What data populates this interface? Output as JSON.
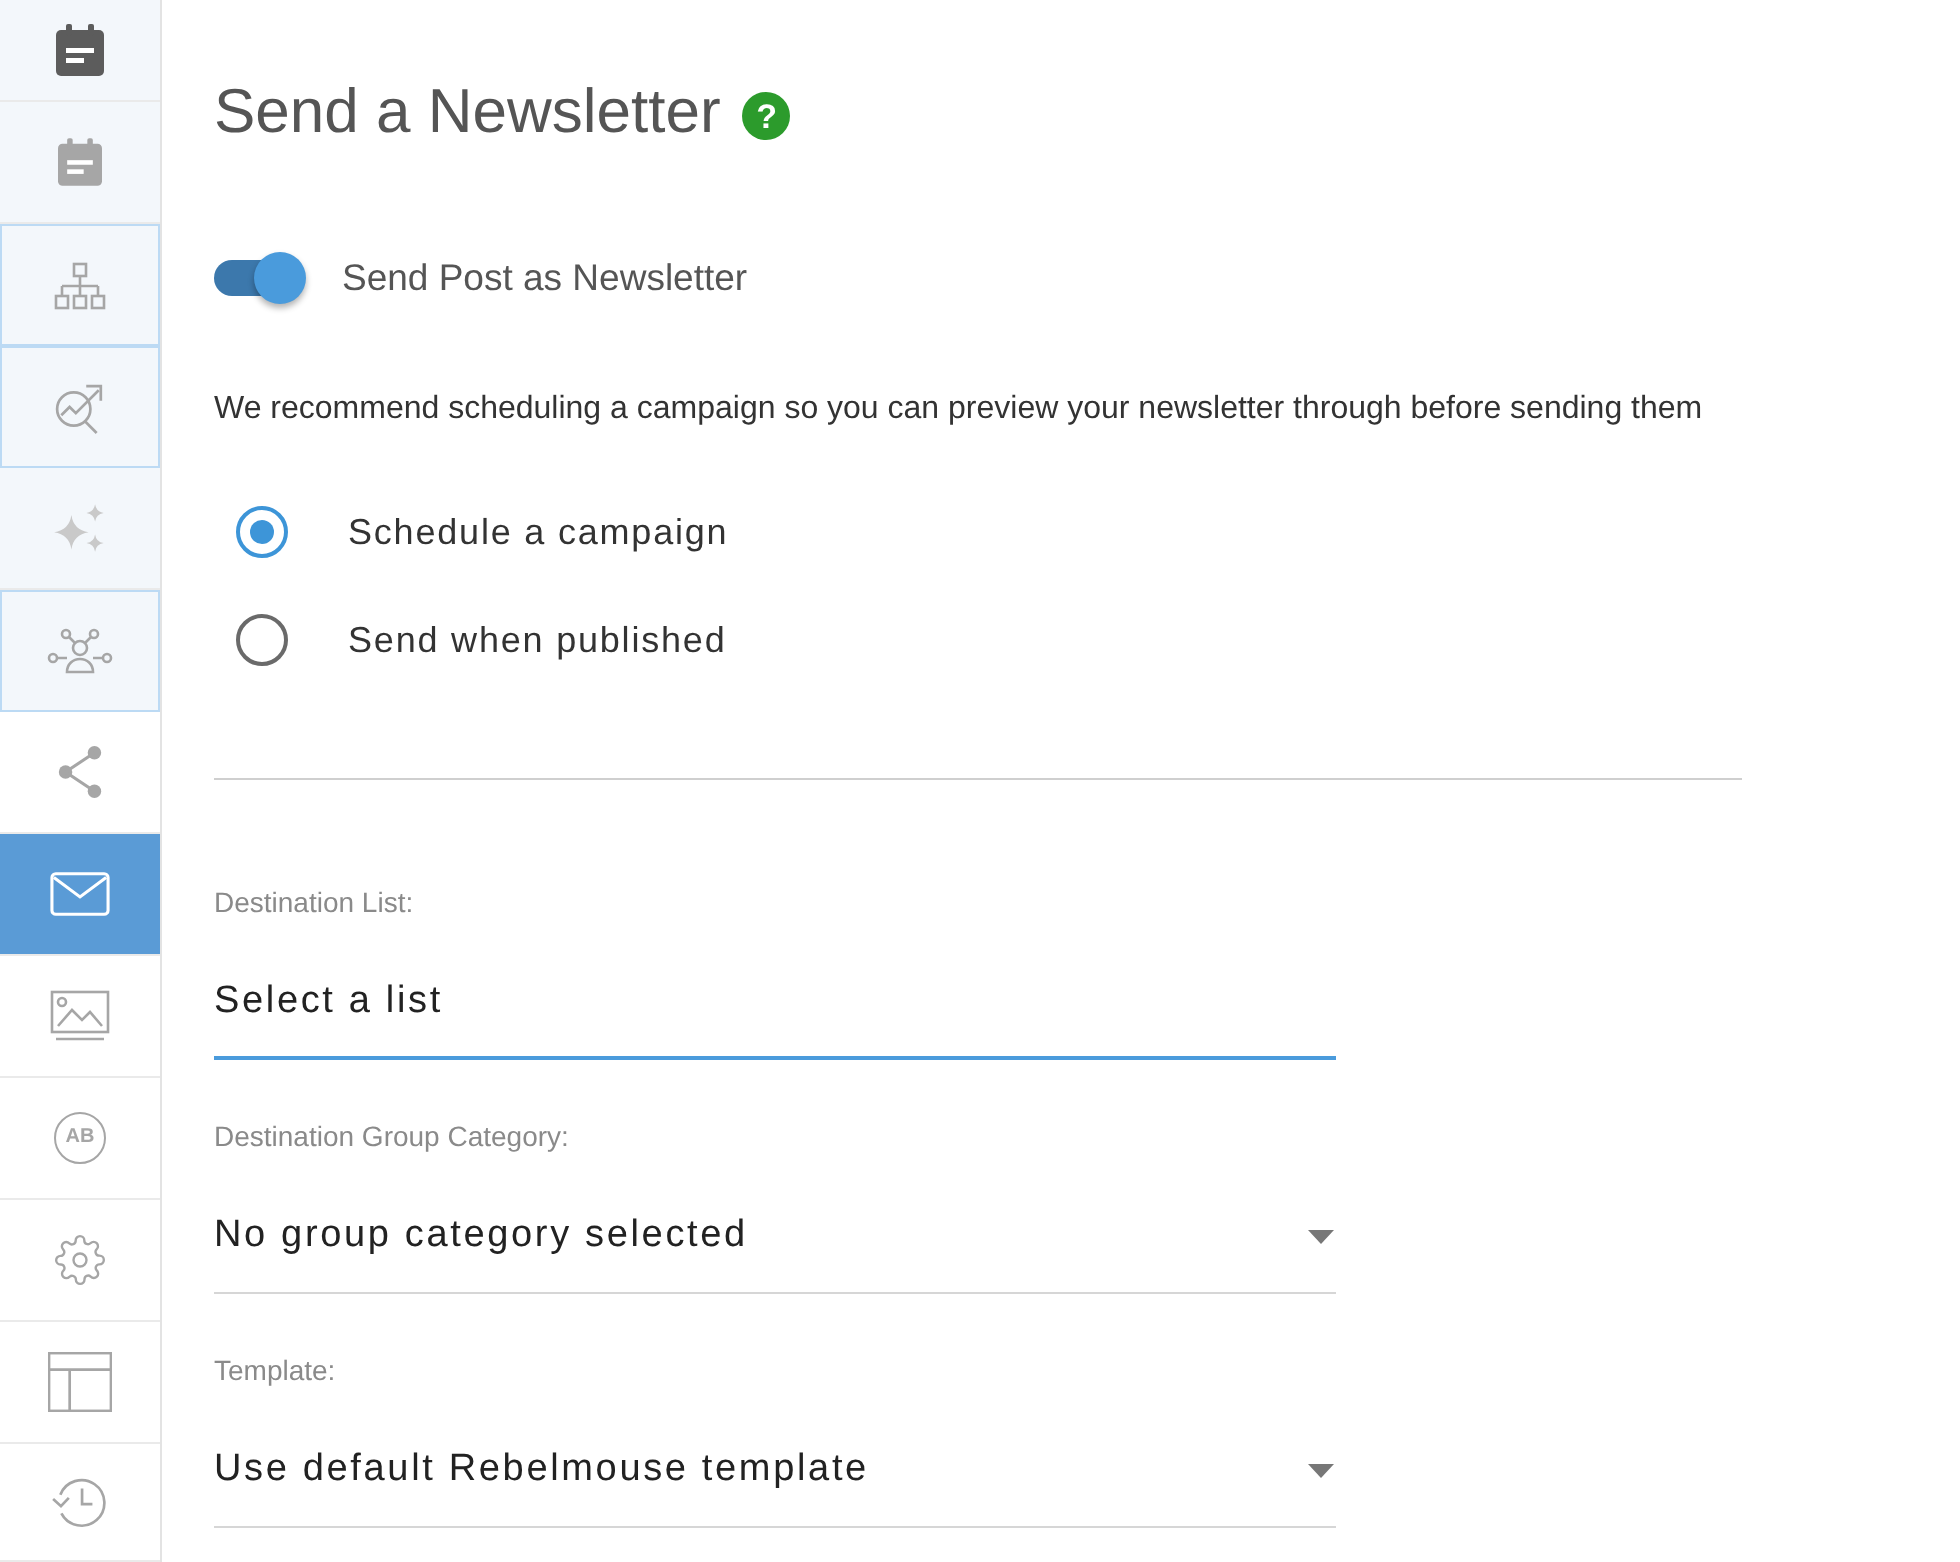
{
  "sidebar": {
    "items": [
      {
        "selected": false,
        "active": true,
        "outlined": false,
        "tinted": true
      },
      {
        "selected": false,
        "active": false,
        "outlined": false,
        "tinted": true
      },
      {
        "selected": false,
        "active": false,
        "outlined": true,
        "tinted": true
      },
      {
        "selected": false,
        "active": false,
        "outlined": true,
        "tinted": true
      },
      {
        "selected": false,
        "active": false,
        "outlined": false,
        "tinted": true
      },
      {
        "selected": false,
        "active": false,
        "outlined": true,
        "tinted": true
      },
      {
        "selected": false,
        "active": false,
        "outlined": false,
        "tinted": false
      },
      {
        "selected": true,
        "active": false,
        "outlined": false,
        "tinted": false
      },
      {
        "selected": false,
        "active": false,
        "outlined": false,
        "tinted": false
      },
      {
        "selected": false,
        "active": false,
        "outlined": false,
        "tinted": false,
        "label": "AB"
      },
      {
        "selected": false,
        "active": false,
        "outlined": false,
        "tinted": false
      },
      {
        "selected": false,
        "active": false,
        "outlined": false,
        "tinted": false
      },
      {
        "selected": false,
        "active": false,
        "outlined": false,
        "tinted": false
      }
    ]
  },
  "title": {
    "text": "Send a Newsletter",
    "help": "?"
  },
  "newsletter_toggle": {
    "label": "Send Post as Newsletter",
    "on": true
  },
  "recommendation": "We recommend scheduling a campaign so you can preview your newsletter through before sending them",
  "send_options": [
    {
      "label": "Schedule a campaign",
      "selected": true
    },
    {
      "label": "Send when published",
      "selected": false
    }
  ],
  "fields": [
    {
      "label": "Destination List:",
      "value": "Select a list",
      "focused": true,
      "dropdown": false
    },
    {
      "label": "Destination Group Category:",
      "value": "No group category selected",
      "focused": false,
      "dropdown": true
    },
    {
      "label": "Template:",
      "value": "Use default Rebelmouse template",
      "focused": false,
      "dropdown": true
    }
  ]
}
